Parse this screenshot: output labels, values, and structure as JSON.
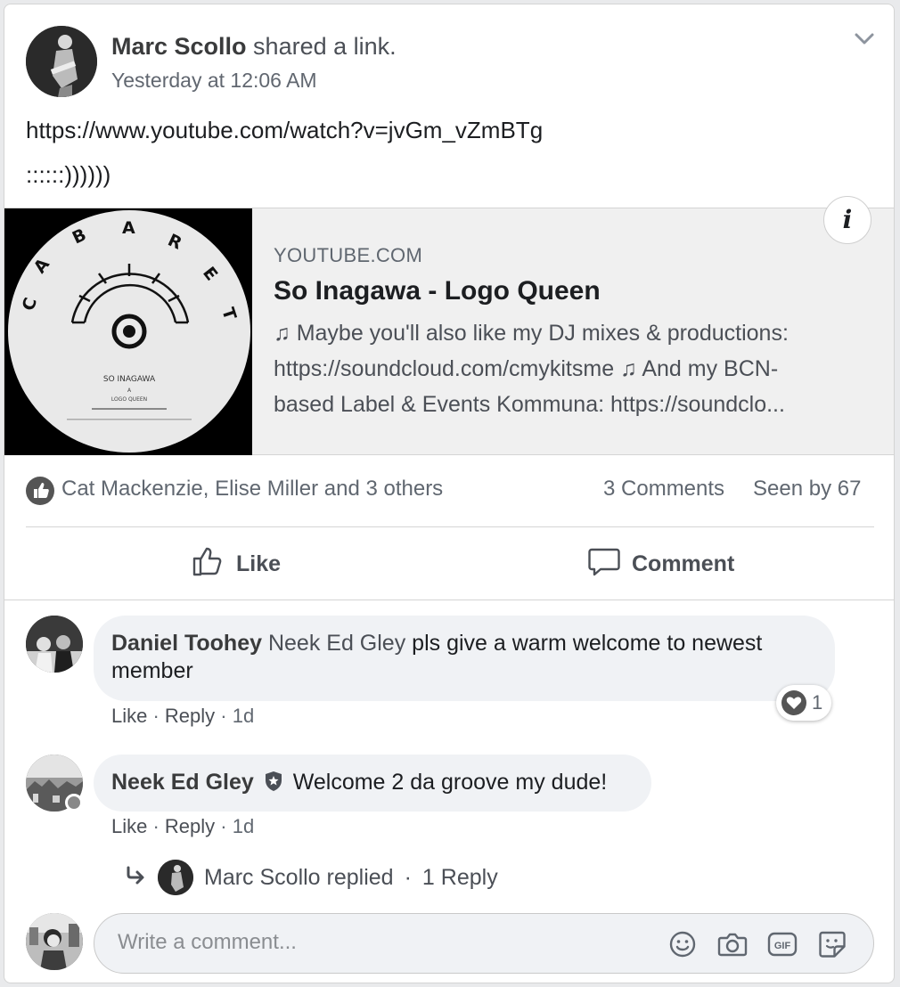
{
  "post": {
    "author": "Marc Scollo",
    "action_text": " shared a link.",
    "timestamp": "Yesterday at 12:06 AM",
    "text_line1": "https://www.youtube.com/watch?v=jvGm_vZmBTg",
    "text_line2": "::::::))))))"
  },
  "link_preview": {
    "domain": "YOUTUBE.COM",
    "title": "So Inagawa - Logo Queen",
    "description_lines": [
      "♫ Maybe you'll also like my DJ mixes & productions:",
      "https://soundcloud.com/cmykitsme ♫ And my BCN-",
      "based Label & Events Kommuna: https://soundclo..."
    ],
    "record_label": "CABARET",
    "record_artist": "SO INAGAWA",
    "record_title": "LOGO QUEEN",
    "info_icon": "info-icon"
  },
  "stats": {
    "reactions": "Cat Mackenzie, Elise Miller and 3 others",
    "comments": "3 Comments",
    "seen": "Seen by 67"
  },
  "actions": {
    "like_label": "Like",
    "comment_label": "Comment"
  },
  "comments": [
    {
      "author": "Daniel Toohey",
      "mention": "Neek Ed Gley",
      "text_line1": " pls give a warm welcome to newest",
      "text_line2": "member",
      "like": "Like",
      "reply": "Reply",
      "time": "1d",
      "reaction_count": "1"
    },
    {
      "author": "Neek Ed Gley",
      "text": "Welcome 2 da groove my dude!",
      "like": "Like",
      "reply": "Reply",
      "time": "1d"
    }
  ],
  "reply_summary": {
    "text": "Marc Scollo replied",
    "count": "1 Reply"
  },
  "composer": {
    "placeholder": "Write a comment..."
  },
  "colors": {
    "background": "#e9eaec",
    "card": "#ffffff",
    "bubble": "#f0f2f5",
    "secondary_text": "#606770"
  }
}
